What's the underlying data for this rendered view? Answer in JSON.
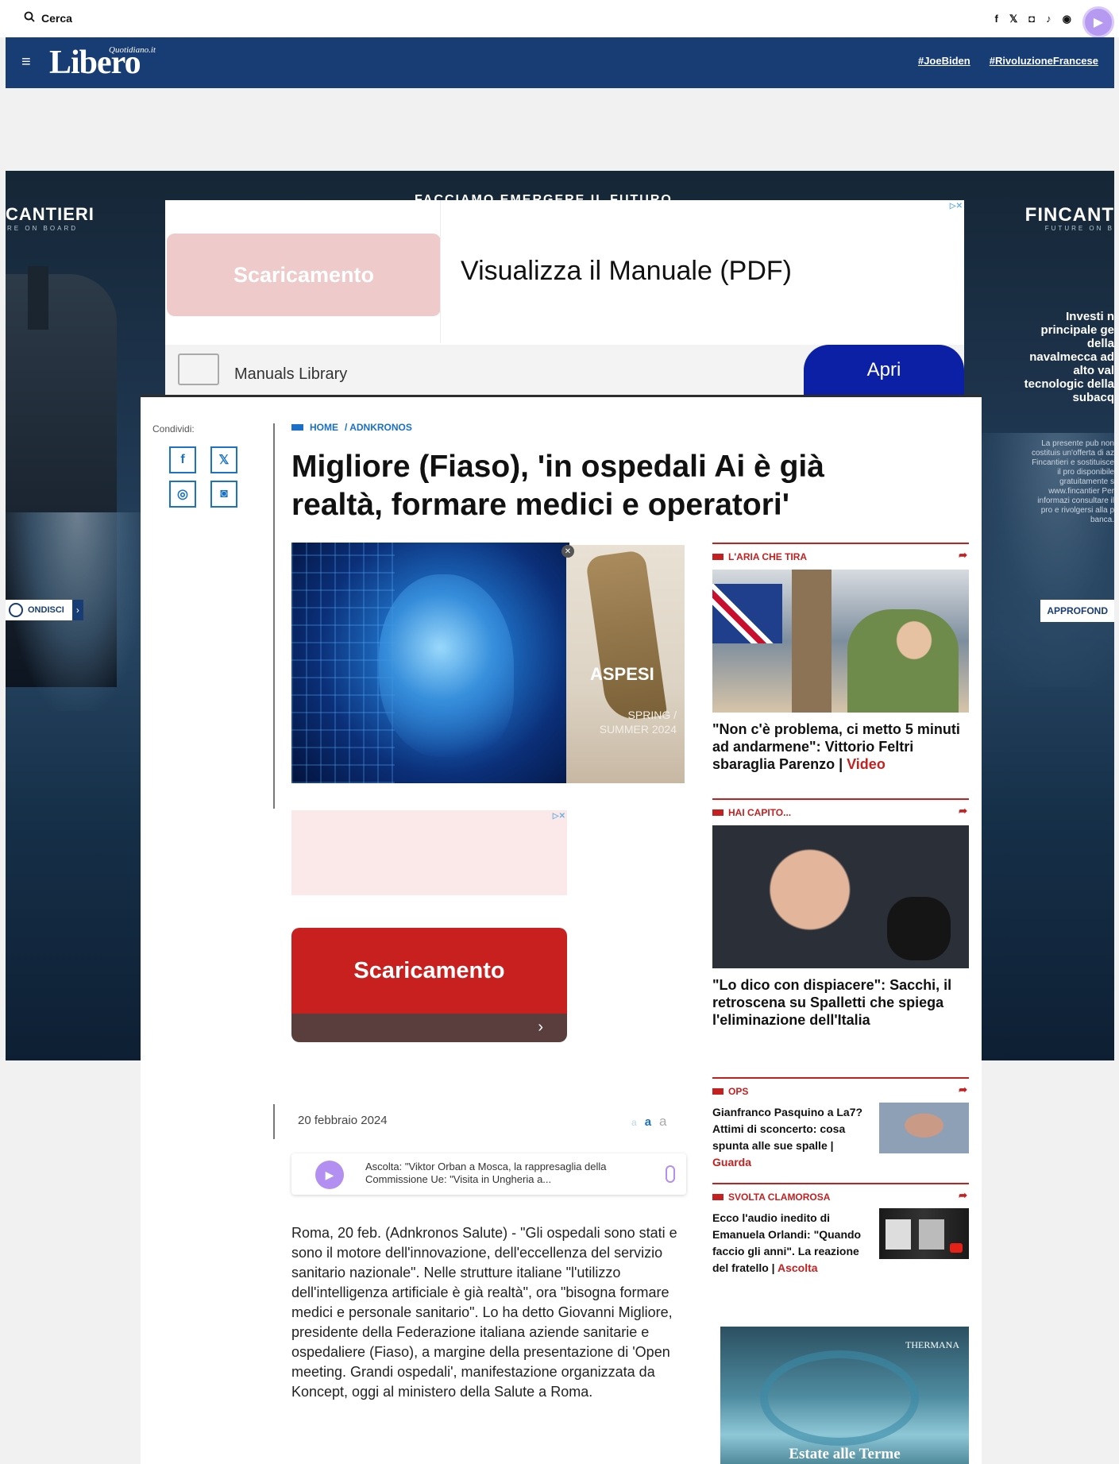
{
  "topbar": {
    "search_label": "Cerca",
    "social": [
      "f",
      "𝕏",
      "◘",
      "♪",
      "◉"
    ]
  },
  "header": {
    "logo": "Libero",
    "logo_sup": "Quotidiano.it",
    "tags": [
      "#JoeBiden",
      "#RivoluzioneFrancese"
    ]
  },
  "background_ad": {
    "brand_left": "CANTIERI",
    "brand_left_sub": "RE ON BOARD",
    "brand_right": "FINCANT",
    "brand_right_sub": "FUTURE ON B",
    "headline": "FACCIAMO EMERGERE IL FUTURO",
    "right_copy": "Investi n principale ge della navalmecca ad alto val tecnologic della subacq",
    "right_small": "La presente pub non costituis un'offerta di az Fincantieri e sostituisce il pro disponibile gratuitamente s www.fincantier Per informazi consultare il pro e rivolgersi alla p banca.",
    "cta_left": "ONDISCI",
    "cta_right": "APPROFOND"
  },
  "top_ad": {
    "download_label": "Scaricamento",
    "title": "Visualizza il Manuale (PDF)",
    "source": "Manuals Library",
    "open_label": "Apri",
    "ad_marks": "▷✕"
  },
  "article": {
    "share_label": "Condividi:",
    "breadcrumb": [
      "HOME",
      "/ ADNKRONOS"
    ],
    "title": "Migliore (Fiaso), 'in ospedali Ai è già realtà, formare medici e operatori'",
    "aspesi_brand": "ASPESI",
    "aspesi_season": "SPRING / SUMMER 2024",
    "ad2_download": "Scaricamento",
    "date": "20 febbraio 2024",
    "font_sizes": [
      "a",
      "a",
      "a"
    ],
    "listen_text": "Ascolta: \"Viktor Orban a Mosca, la rappresaglia della Commissione Ue: \"Visita in Ungheria a...",
    "body": "Roma, 20 feb. (Adnkronos Salute) - \"Gli ospedali sono stati e sono il motore dell'innovazione, dell'eccellenza del servizio sanitario nazionale\". Nelle strutture italiane \"l'utilizzo dell'intelligenza artificiale è già realtà\", ora \"bisogna formare medici e personale sanitario\". Lo ha detto Giovanni Migliore, presidente della Federazione italiana aziende sanitarie e ospedaliere (Fiaso), a margine della presentazione di 'Open meeting. Grandi ospedali', manifestazione organizzata da Koncept, oggi al ministero della Salute a Roma."
  },
  "sidebar": {
    "s1": {
      "label": "L'ARIA CHE TIRA",
      "title": "\"Non c'è problema, ci metto 5 minuti ad andarmene\": Vittorio Feltri sbaraglia Parenzo |",
      "tag": "Video"
    },
    "s2": {
      "label": "HAI CAPITO...",
      "title": "\"Lo dico con dispiacere\": Sacchi, il retroscena su Spalletti che spiega l'eliminazione dell'Italia"
    },
    "s3": {
      "label": "OPS",
      "title": "Gianfranco Pasquino a La7? Attimi di sconcerto: cosa spunta alle sue spalle |",
      "tag": "Guarda"
    },
    "s4": {
      "label": "SVOLTA CLAMOROSA",
      "title": "Ecco l'audio inedito di Emanuela Orlandi: \"Quando faccio gli anni\". La reazione del fratello |",
      "tag": "Ascolta"
    },
    "thermana": {
      "logo": "THERMANA",
      "title": "Estate alle Terme"
    }
  },
  "colors": {
    "header_blue": "#173d74",
    "accent_red": "#c52020",
    "link_blue": "#1a6fc8"
  }
}
